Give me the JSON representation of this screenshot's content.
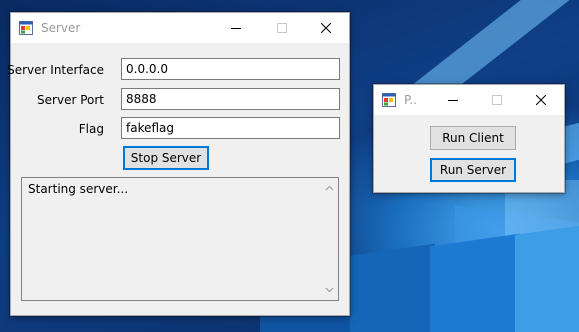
{
  "server_window": {
    "title": "Server",
    "icons": {
      "app": "app-icon",
      "minimize": "minimize-icon",
      "maximize": "maximize-icon",
      "close": "close-icon"
    },
    "fields": {
      "interface": {
        "label": "Server Interface",
        "value": "0.0.0.0"
      },
      "port": {
        "label": "Server Port",
        "value": "8888"
      },
      "flag": {
        "label": "Flag",
        "value": "fakeflag"
      }
    },
    "stop_button_label": "Stop Server",
    "log_text": "Starting server..."
  },
  "launcher_window": {
    "title": "P..",
    "run_client_label": "Run Client",
    "run_server_label": "Run Server"
  },
  "colors": {
    "accent": "#0078d7",
    "window_bg": "#f0f0f0",
    "button_bg": "#e1e1e1"
  }
}
